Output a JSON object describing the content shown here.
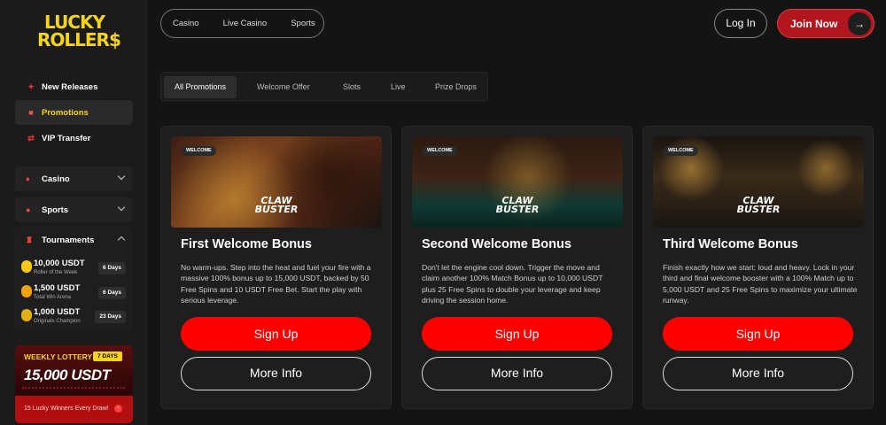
{
  "brand": {
    "line1": "LUCKY",
    "line2": "ROLLER$"
  },
  "sidebar": {
    "nav": [
      {
        "label": "New Releases",
        "icon": "sparkle-icon"
      },
      {
        "label": "Promotions",
        "icon": "gift-icon"
      },
      {
        "label": "VIP Transfer",
        "icon": "transfer-icon"
      }
    ],
    "groups": [
      {
        "label": "Casino",
        "icon": "dice-icon"
      },
      {
        "label": "Sports",
        "icon": "ball-icon"
      },
      {
        "label": "Tournaments",
        "icon": "trophy-icon"
      }
    ],
    "tournaments": [
      {
        "amount": "10,000 USDT",
        "sub": "Roller of the Week",
        "days": "6 Days"
      },
      {
        "amount": "1,500 USDT",
        "sub": "Total Win Arena",
        "days": "6 Days"
      },
      {
        "amount": "1,000 USDT",
        "sub": "Originals Champion",
        "days": "23 Days"
      }
    ],
    "lottery": {
      "title": "WEEKLY LOTTERY",
      "badge": "7 DAYS",
      "amount": "15,000 USDT",
      "footer": "15 Lucky Winners Every Draw!"
    }
  },
  "header": {
    "tabs": [
      "Casino",
      "Live Casino",
      "Sports"
    ],
    "login": "Log In",
    "join": "Join Now"
  },
  "filters": [
    "All Promotions",
    "Welcome Offer",
    "Slots",
    "Live",
    "Prize Drops"
  ],
  "cards": [
    {
      "badge": "WELCOME",
      "logo_line1": "CLAW",
      "logo_line2": "BUSTER",
      "title": "First Welcome Bonus",
      "desc": "No warm-ups. Step into the heat and fuel your fire with a massive 100% bonus up to 15,000 USDT, backed by 50 Free Spins and 10 USDT Free Bet. Start the play with serious leverage.",
      "signup": "Sign Up",
      "more": "More Info"
    },
    {
      "badge": "WELCOME",
      "logo_line1": "CLAW",
      "logo_line2": "BUSTER",
      "title": "Second Welcome Bonus",
      "desc": "Don't let the engine cool down. Trigger the move and claim another 100% Match Bonus up to 10,000 USDT plus 25 Free Spins to double your leverage and keep driving the session home.",
      "signup": "Sign Up",
      "more": "More Info"
    },
    {
      "badge": "WELCOME",
      "logo_line1": "CLAW",
      "logo_line2": "BUSTER",
      "title": "Third Welcome Bonus",
      "desc": "Finish exactly how we start: loud and heavy. Lock in your third and final welcome booster with a 100% Match up to 5,000 USDT and 25 Free Spins to maximize your ultimate runway.",
      "signup": "Sign Up",
      "more": "More Info"
    }
  ]
}
